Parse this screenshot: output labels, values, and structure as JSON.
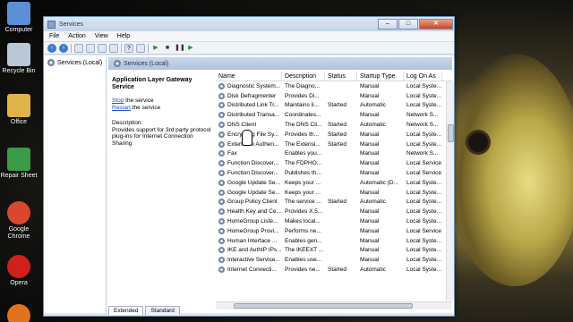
{
  "desktop": {
    "icons": [
      {
        "label": "Computer",
        "color": "#5b8fd6"
      },
      {
        "label": "Recycle Bin",
        "color": "#b9c7d6"
      },
      {
        "label": "Office",
        "color": "#e0b34a"
      },
      {
        "label": "Repair Sheet",
        "color": "#3a9a45"
      },
      {
        "label": "Google Chrome",
        "color": "#d9482c"
      },
      {
        "label": "Opera",
        "color": "#d0201d"
      }
    ]
  },
  "window": {
    "title": "Services",
    "buttons": {
      "minimize": "–",
      "maximize": "□",
      "close": "✕"
    }
  },
  "menu": [
    "File",
    "Action",
    "View",
    "Help"
  ],
  "tree": {
    "root": "Services (Local)"
  },
  "pane_header": "Services (Local)",
  "detail": {
    "service_name": "Application Layer Gateway Service",
    "stop_link": "Stop",
    "stop_text": " the service",
    "restart_link": "Restart",
    "restart_text": " the service",
    "desc_label": "Description:",
    "description": "Provides support for 3rd party protocol plug-ins for Internet Connection Sharing"
  },
  "columns": [
    "Name",
    "Description",
    "Status",
    "Startup Type",
    "Log On As"
  ],
  "services": [
    {
      "name": "Diagnostic System...",
      "desc": "The Diagno...",
      "status": "",
      "startup": "Manual",
      "logon": "Local Syste..."
    },
    {
      "name": "Disk Defragmenter",
      "desc": "Provides Di...",
      "status": "",
      "startup": "Manual",
      "logon": "Local Syste..."
    },
    {
      "name": "Distributed Link Tr...",
      "desc": "Maintains li...",
      "status": "Started",
      "startup": "Automatic",
      "logon": "Local Syste..."
    },
    {
      "name": "Distributed Transa...",
      "desc": "Coordinates...",
      "status": "",
      "startup": "Manual",
      "logon": "Network S..."
    },
    {
      "name": "DNS Client",
      "desc": "The DNS Cli...",
      "status": "Started",
      "startup": "Automatic",
      "logon": "Network S..."
    },
    {
      "name": "Encrypting File Sy...",
      "desc": "Provides th...",
      "status": "Started",
      "startup": "Manual",
      "logon": "Local Syste..."
    },
    {
      "name": "Extensible Authen...",
      "desc": "The Extensi...",
      "status": "Started",
      "startup": "Manual",
      "logon": "Local Syste..."
    },
    {
      "name": "Fax",
      "desc": "Enables you...",
      "status": "",
      "startup": "Manual",
      "logon": "Network S..."
    },
    {
      "name": "Function Discover...",
      "desc": "The FDPHO...",
      "status": "",
      "startup": "Manual",
      "logon": "Local Service"
    },
    {
      "name": "Function Discover...",
      "desc": "Publishes th...",
      "status": "",
      "startup": "Manual",
      "logon": "Local Service"
    },
    {
      "name": "Google Update Se...",
      "desc": "Keeps your ...",
      "status": "",
      "startup": "Automatic (D...",
      "logon": "Local Syste..."
    },
    {
      "name": "Google Update Se...",
      "desc": "Keeps your ...",
      "status": "",
      "startup": "Manual",
      "logon": "Local Syste..."
    },
    {
      "name": "Group Policy Client",
      "desc": "The service ...",
      "status": "Started",
      "startup": "Automatic",
      "logon": "Local Syste..."
    },
    {
      "name": "Health Key and Ce...",
      "desc": "Provides X.5...",
      "status": "",
      "startup": "Manual",
      "logon": "Local Syste..."
    },
    {
      "name": "HomeGroup Liste...",
      "desc": "Makes local...",
      "status": "",
      "startup": "Manual",
      "logon": "Local Syste..."
    },
    {
      "name": "HomeGroup Provi...",
      "desc": "Performs ne...",
      "status": "",
      "startup": "Manual",
      "logon": "Local Service"
    },
    {
      "name": "Human Interface ...",
      "desc": "Enables gen...",
      "status": "",
      "startup": "Manual",
      "logon": "Local Syste..."
    },
    {
      "name": "IKE and AuthIP IPs...",
      "desc": "The IKEEXT ...",
      "status": "",
      "startup": "Manual",
      "logon": "Local Syste..."
    },
    {
      "name": "Interactive Service...",
      "desc": "Enables use...",
      "status": "",
      "startup": "Manual",
      "logon": "Local Syste..."
    },
    {
      "name": "Internet Connecti...",
      "desc": "Provides ne...",
      "status": "Started",
      "startup": "Automatic",
      "logon": "Local Syste..."
    }
  ],
  "tabs": [
    "Extended",
    "Standard"
  ]
}
